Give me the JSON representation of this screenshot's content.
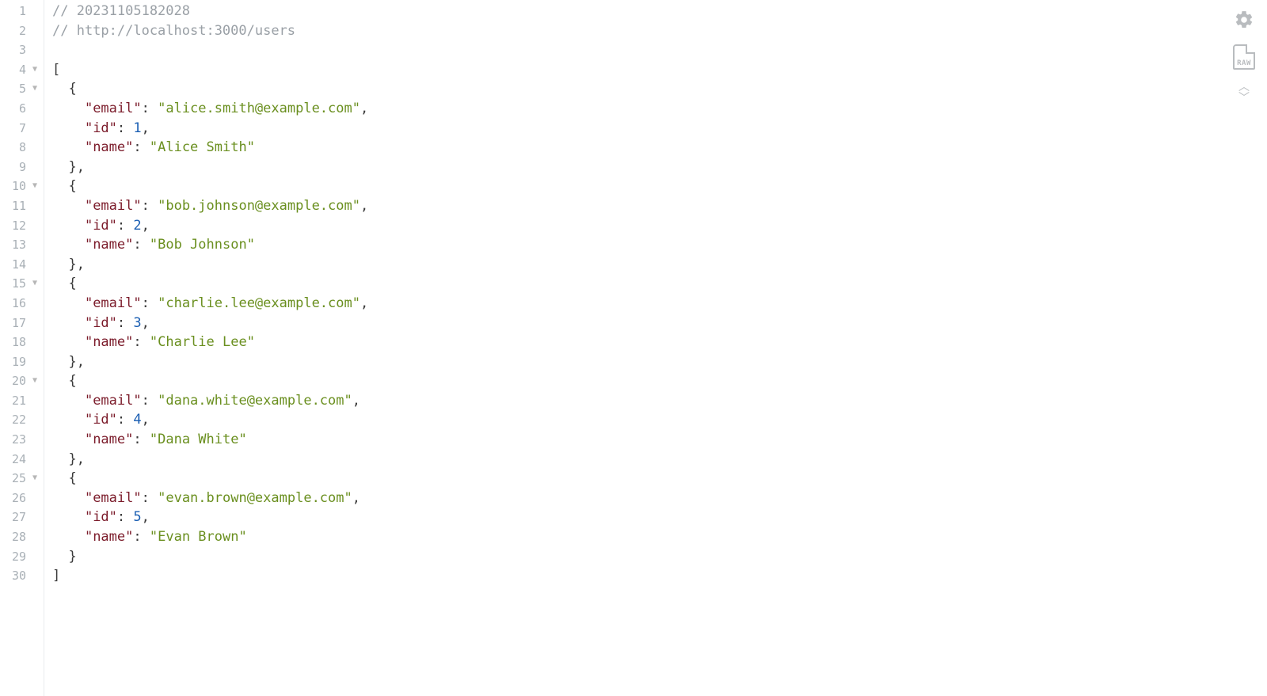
{
  "meta": {
    "timestamp_comment": "// 20231105182028",
    "url_comment": "// http://localhost:3000/users"
  },
  "json_keys": {
    "email": "\"email\"",
    "id": "\"id\"",
    "name": "\"name\""
  },
  "users": [
    {
      "email": "\"alice.smith@example.com\"",
      "id": "1",
      "name": "\"Alice Smith\""
    },
    {
      "email": "\"bob.johnson@example.com\"",
      "id": "2",
      "name": "\"Bob Johnson\""
    },
    {
      "email": "\"charlie.lee@example.com\"",
      "id": "3",
      "name": "\"Charlie Lee\""
    },
    {
      "email": "\"dana.white@example.com\"",
      "id": "4",
      "name": "\"Dana White\""
    },
    {
      "email": "\"evan.brown@example.com\"",
      "id": "5",
      "name": "\"Evan Brown\""
    }
  ],
  "punct": {
    "lbracket": "[",
    "rbracket": "]",
    "lbrace": "{",
    "rbrace": "}",
    "rbrace_comma": "},",
    "colon": ":",
    "comma": ","
  },
  "gutter": {
    "lines": [
      "1",
      "2",
      "3",
      "4",
      "5",
      "6",
      "7",
      "8",
      "9",
      "10",
      "11",
      "12",
      "13",
      "14",
      "15",
      "16",
      "17",
      "18",
      "19",
      "20",
      "21",
      "22",
      "23",
      "24",
      "25",
      "26",
      "27",
      "28",
      "29",
      "30"
    ],
    "fold_lines": [
      4,
      5,
      10,
      15,
      20,
      25
    ],
    "fold_glyph": "▼"
  },
  "toolbar": {
    "gear_label": "settings",
    "raw_label": "RAW",
    "collapse_label": "collapse-expand"
  }
}
